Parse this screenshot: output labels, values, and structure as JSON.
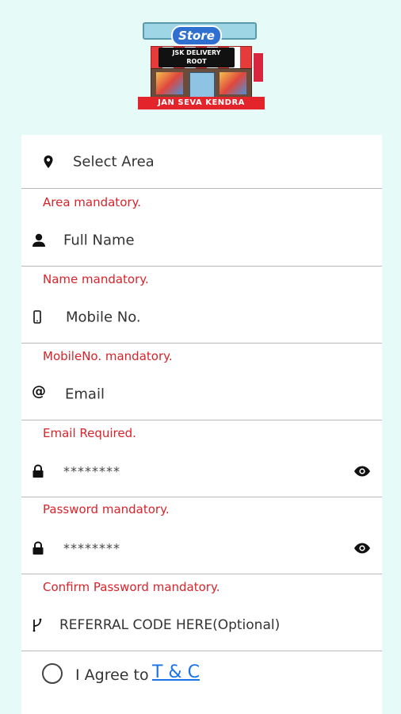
{
  "logo": {
    "store_text": "Store",
    "sign_text_1": "JSK DELIVERY",
    "sign_text_2": "ROOT",
    "banner_text": "JAN SEVA KENDRA"
  },
  "form": {
    "area": {
      "placeholder": "Select Area",
      "error": "Area mandatory.",
      "icon": "location-pin-icon"
    },
    "name": {
      "placeholder": "Full Name",
      "error": "Name mandatory.",
      "icon": "person-icon"
    },
    "mobile": {
      "placeholder": "Mobile No.",
      "error": "MobileNo. mandatory.",
      "icon": "phone-icon"
    },
    "email": {
      "placeholder": "Email",
      "error": "Email Required.",
      "icon": "at-sign-icon"
    },
    "password": {
      "value": "********",
      "error": "Password mandatory.",
      "icon": "lock-icon",
      "toggle_icon": "eye-icon"
    },
    "confirm_password": {
      "value": "********",
      "error": "Confirm Password mandatory.",
      "icon": "lock-icon",
      "toggle_icon": "eye-icon"
    },
    "referral": {
      "placeholder": "REFERRAL CODE HERE(Optional)",
      "icon": "branch-icon"
    },
    "agree": {
      "text": "I Agree to",
      "link": "T & C"
    }
  },
  "colors": {
    "background": "#e6fbf8",
    "error": "#d8232a",
    "link": "#1a73e8"
  }
}
